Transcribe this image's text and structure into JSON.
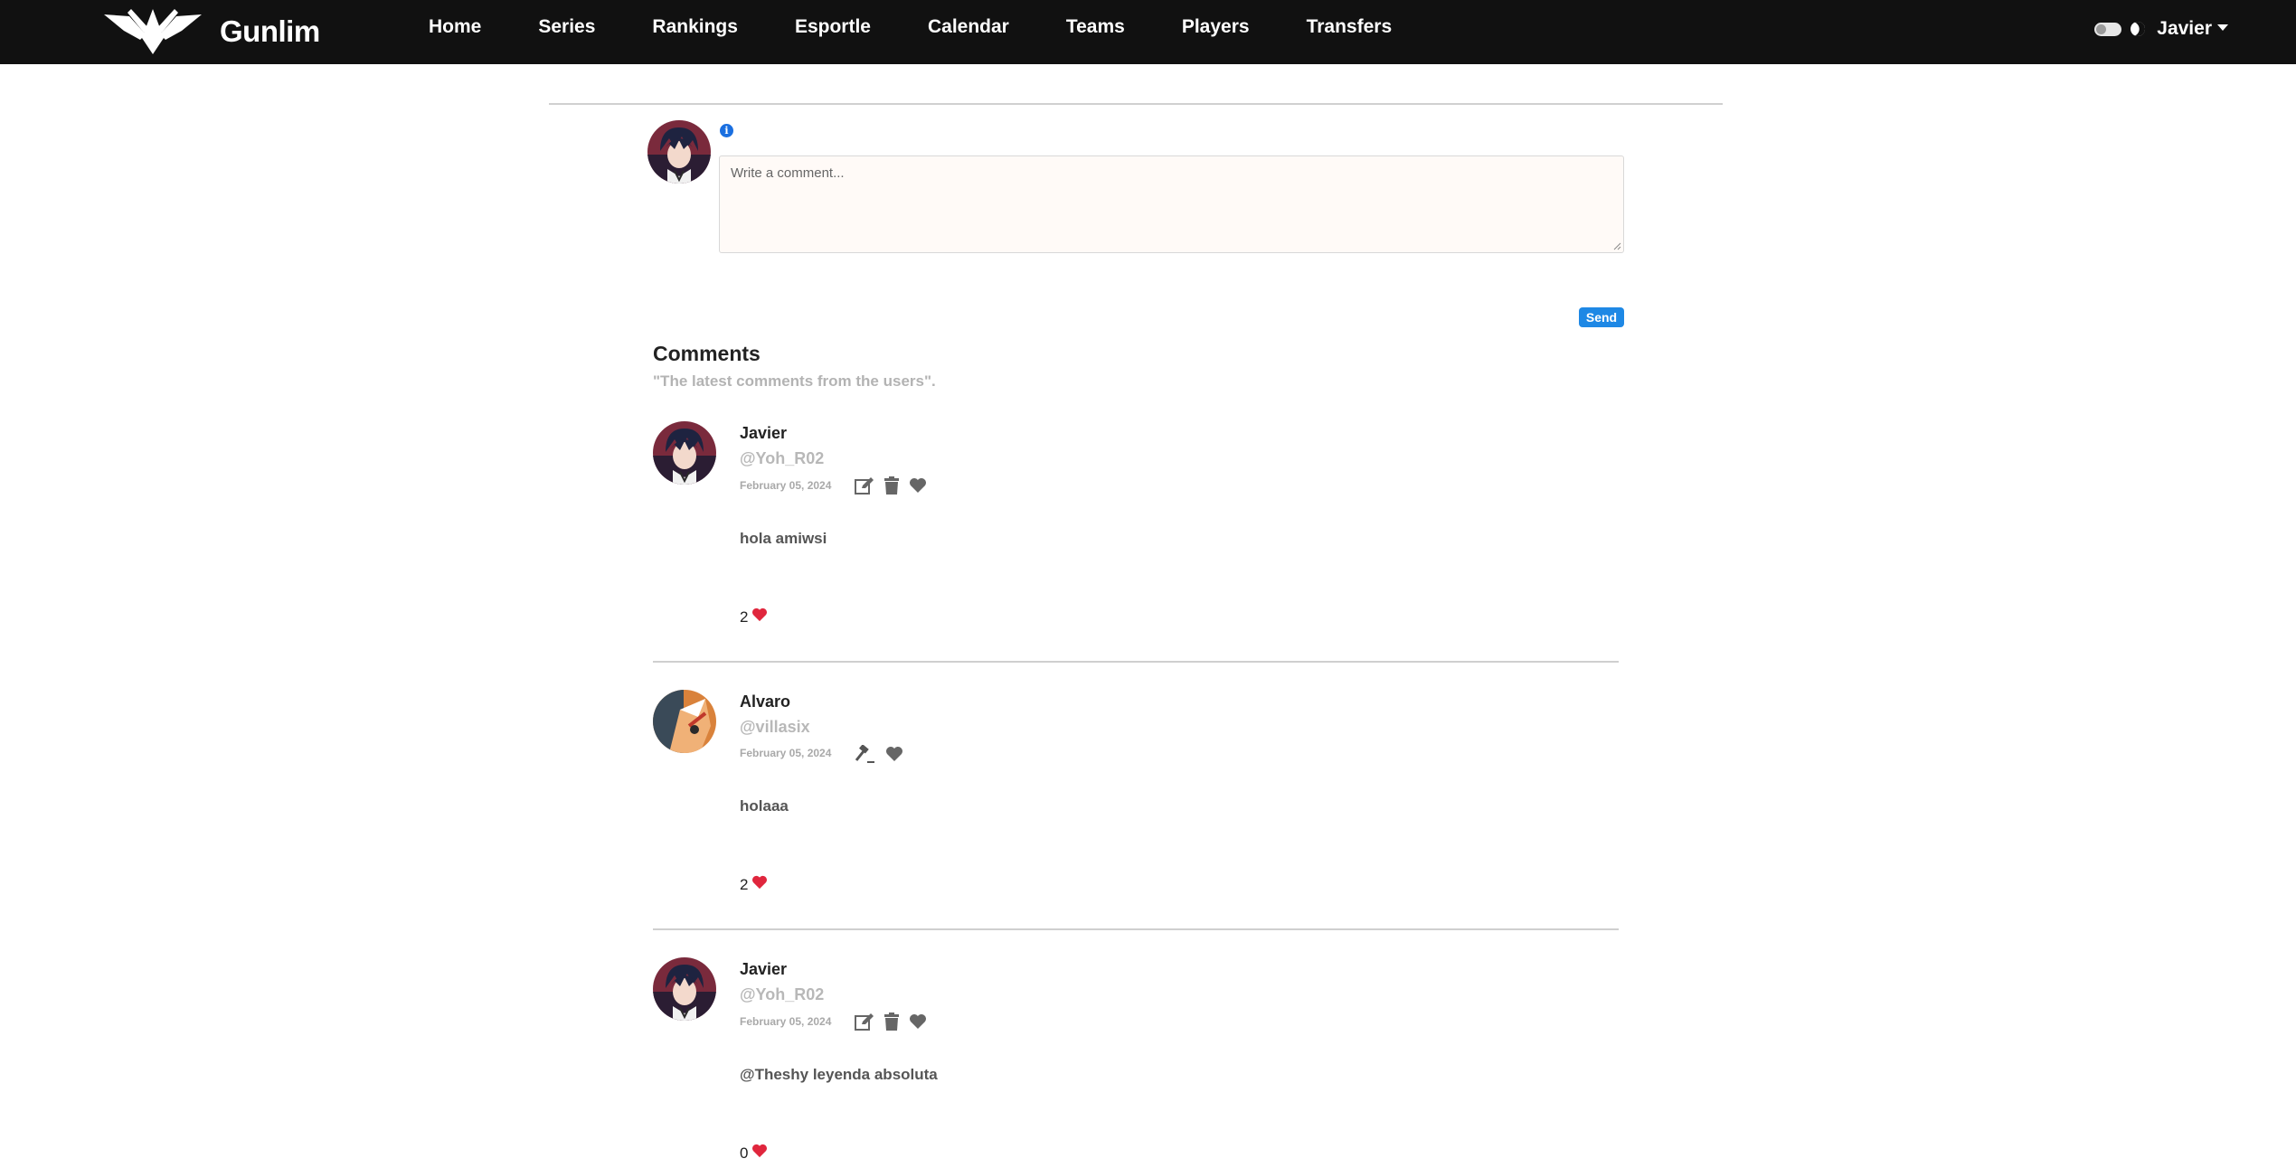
{
  "nav": {
    "brand": "Gunlim",
    "items": [
      {
        "label": "Home"
      },
      {
        "label": "Series"
      },
      {
        "label": "Rankings"
      },
      {
        "label": "Esportle"
      },
      {
        "label": "Calendar"
      },
      {
        "label": "Teams"
      },
      {
        "label": "Players"
      },
      {
        "label": "Transfers"
      }
    ],
    "user": "Javier",
    "theme_toggle_icon": "toggle-icon",
    "dark_mode_icon": "moon-icon"
  },
  "composer": {
    "info_icon": "info-icon",
    "placeholder": "Write a comment...",
    "send_label": "Send"
  },
  "comments_section": {
    "title": "Comments",
    "subtitle": "\"The latest comments from the users\"."
  },
  "comments": [
    {
      "name": "Javier",
      "handle": "@Yoh_R02",
      "date": "February 05, 2024",
      "text": "hola amiwsi",
      "likes": "2",
      "actions": [
        "edit-icon",
        "trash-icon",
        "heart-icon"
      ]
    },
    {
      "name": "Alvaro",
      "handle": "@villasix",
      "date": "February 05, 2024",
      "text": "holaaa",
      "likes": "2",
      "actions": [
        "gavel-icon",
        "heart-icon"
      ]
    },
    {
      "name": "Javier",
      "handle": "@Yoh_R02",
      "date": "February 05, 2024",
      "text": "@Theshy leyenda absoluta",
      "likes": "0",
      "actions": [
        "edit-icon",
        "trash-icon",
        "heart-icon"
      ]
    }
  ],
  "colors": {
    "navbar": "#111111",
    "send_button": "#1e88e5",
    "like_heart": "#e0263d",
    "action_icon": "#666666"
  }
}
